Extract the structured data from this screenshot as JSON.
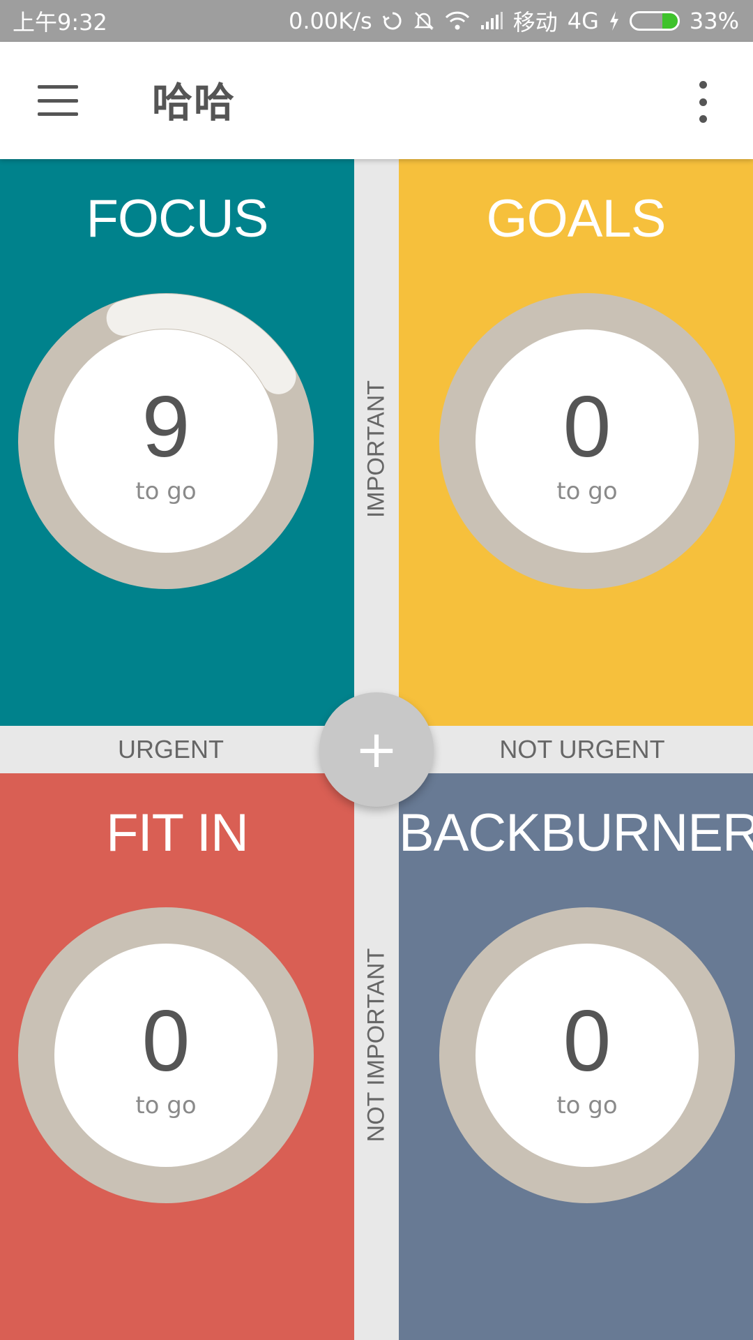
{
  "status_bar": {
    "time": "上午9:32",
    "speed": "0.00K/s",
    "carrier": "移动",
    "network": "4G",
    "battery": "33%",
    "battery_level": 0.33,
    "icons": [
      "sync-icon",
      "mute-icon",
      "wifi-icon",
      "signal-icon",
      "charging-icon",
      "battery-icon"
    ]
  },
  "app_bar": {
    "title": "哈哈",
    "menu_icon": "hamburger-menu-icon",
    "more_icon": "more-vert-icon"
  },
  "quadrants": {
    "focus": {
      "title": "FOCUS",
      "count": "9",
      "caption": "to go",
      "color": "#00828c",
      "progress": 0.22
    },
    "goals": {
      "title": "GOALS",
      "count": "0",
      "caption": "to go",
      "color": "#f6c03c",
      "progress": 0
    },
    "fit_in": {
      "title": "FIT IN",
      "count": "0",
      "caption": "to go",
      "color": "#d95f54",
      "progress": 0
    },
    "backburner": {
      "title": "BACKBURNER",
      "count": "0",
      "caption": "to go",
      "color": "#687a94",
      "progress": 0
    }
  },
  "axes": {
    "urgent": "URGENT",
    "not_urgent": "NOT URGENT",
    "important": "IMPORTANT",
    "not_important": "NOT IMPORTANT"
  },
  "fab": {
    "label": "+",
    "icon": "add-icon"
  },
  "colors": {
    "ring_track": "#c9c1b5",
    "ring_progress": "#f2f0ec",
    "divider": "#e8e8e8"
  }
}
